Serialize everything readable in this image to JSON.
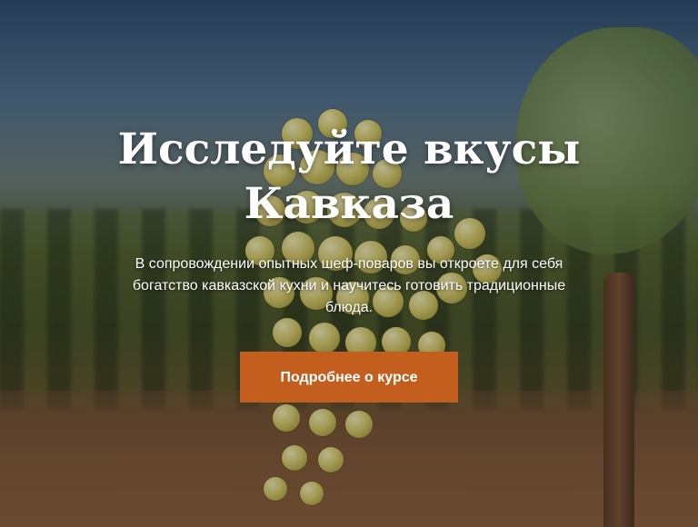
{
  "hero": {
    "title": "Исследуйте вкусы Кавказа",
    "subtitle": "В сопровождении опытных шеф-поваров вы откроете для себя богатство кавказской кухни и научитесь готовить традиционные блюда.",
    "cta_label": "Подробнее о курсе",
    "background_image": "vineyard-grapes-image"
  },
  "colors": {
    "cta_background": "#c45e1f",
    "text": "#ffffff"
  }
}
